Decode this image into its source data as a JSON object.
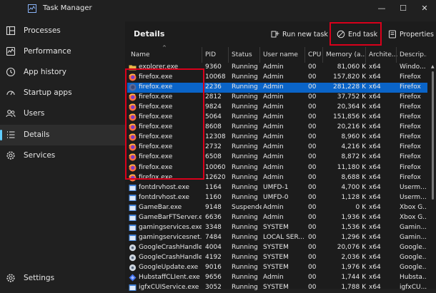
{
  "window": {
    "title": "Task Manager",
    "minimize": "—",
    "maximize": "☐",
    "close": "✕"
  },
  "sidebar": {
    "items": [
      {
        "label": "Processes",
        "icon": "grid-icon"
      },
      {
        "label": "Performance",
        "icon": "performance-icon"
      },
      {
        "label": "App history",
        "icon": "history-icon"
      },
      {
        "label": "Startup apps",
        "icon": "speedometer-icon"
      },
      {
        "label": "Users",
        "icon": "users-icon"
      },
      {
        "label": "Details",
        "icon": "list-icon",
        "active": true
      },
      {
        "label": "Services",
        "icon": "gear-icon"
      }
    ],
    "settings": "Settings"
  },
  "page": {
    "heading": "Details",
    "run_new_task": "Run new task",
    "end_task": "End task",
    "properties": "Properties"
  },
  "columns": [
    "Name",
    "PID",
    "Status",
    "User name",
    "CPU",
    "Memory (a...",
    "Archite...",
    "Descrip..."
  ],
  "rows": [
    {
      "name": "explorer.exe",
      "pid": "9360",
      "status": "Running",
      "user": "Admin",
      "cpu": "00",
      "mem": "81,060 K",
      "arch": "x64",
      "desc": "Windo...",
      "icon": "folder"
    },
    {
      "name": "firefox.exe",
      "pid": "10068",
      "status": "Running",
      "user": "Admin",
      "cpu": "00",
      "mem": "157,820 K",
      "arch": "x64",
      "desc": "Firefox",
      "icon": "firefox"
    },
    {
      "name": "firefox.exe",
      "pid": "2236",
      "status": "Running",
      "user": "Admin",
      "cpu": "00",
      "mem": "281,228 K",
      "arch": "x64",
      "desc": "Firefox",
      "icon": "firefox-dim",
      "selected": true
    },
    {
      "name": "firefox.exe",
      "pid": "2812",
      "status": "Running",
      "user": "Admin",
      "cpu": "00",
      "mem": "37,752 K",
      "arch": "x64",
      "desc": "Firefox",
      "icon": "firefox"
    },
    {
      "name": "firefox.exe",
      "pid": "9824",
      "status": "Running",
      "user": "Admin",
      "cpu": "00",
      "mem": "20,364 K",
      "arch": "x64",
      "desc": "Firefox",
      "icon": "firefox"
    },
    {
      "name": "firefox.exe",
      "pid": "5064",
      "status": "Running",
      "user": "Admin",
      "cpu": "00",
      "mem": "151,856 K",
      "arch": "x64",
      "desc": "Firefox",
      "icon": "firefox"
    },
    {
      "name": "firefox.exe",
      "pid": "8608",
      "status": "Running",
      "user": "Admin",
      "cpu": "00",
      "mem": "20,216 K",
      "arch": "x64",
      "desc": "Firefox",
      "icon": "firefox"
    },
    {
      "name": "firefox.exe",
      "pid": "12308",
      "status": "Running",
      "user": "Admin",
      "cpu": "00",
      "mem": "8,960 K",
      "arch": "x64",
      "desc": "Firefox",
      "icon": "firefox"
    },
    {
      "name": "firefox.exe",
      "pid": "2732",
      "status": "Running",
      "user": "Admin",
      "cpu": "00",
      "mem": "4,216 K",
      "arch": "x64",
      "desc": "Firefox",
      "icon": "firefox"
    },
    {
      "name": "firefox.exe",
      "pid": "6508",
      "status": "Running",
      "user": "Admin",
      "cpu": "00",
      "mem": "8,872 K",
      "arch": "x64",
      "desc": "Firefox",
      "icon": "firefox"
    },
    {
      "name": "firefox.exe",
      "pid": "10060",
      "status": "Running",
      "user": "Admin",
      "cpu": "00",
      "mem": "11,180 K",
      "arch": "x64",
      "desc": "Firefox",
      "icon": "firefox"
    },
    {
      "name": "firefox.exe",
      "pid": "12620",
      "status": "Running",
      "user": "Admin",
      "cpu": "00",
      "mem": "8,688 K",
      "arch": "x64",
      "desc": "Firefox",
      "icon": "firefox"
    },
    {
      "name": "fontdrvhost.exe",
      "pid": "1164",
      "status": "Running",
      "user": "UMFD-1",
      "cpu": "00",
      "mem": "4,700 K",
      "arch": "x64",
      "desc": "Userm...",
      "icon": "window"
    },
    {
      "name": "fontdrvhost.exe",
      "pid": "1160",
      "status": "Running",
      "user": "UMFD-0",
      "cpu": "00",
      "mem": "1,128 K",
      "arch": "x64",
      "desc": "Userm...",
      "icon": "window"
    },
    {
      "name": "GameBar.exe",
      "pid": "9148",
      "status": "Suspended",
      "user": "Admin",
      "cpu": "00",
      "mem": "0 K",
      "arch": "x64",
      "desc": "Xbox G...",
      "icon": "window"
    },
    {
      "name": "GameBarFTServer.exe",
      "pid": "6636",
      "status": "Running",
      "user": "Admin",
      "cpu": "00",
      "mem": "1,936 K",
      "arch": "x64",
      "desc": "Xbox G...",
      "icon": "window"
    },
    {
      "name": "gamingservices.exe",
      "pid": "3348",
      "status": "Running",
      "user": "SYSTEM",
      "cpu": "00",
      "mem": "1,536 K",
      "arch": "x64",
      "desc": "Gamin...",
      "icon": "window"
    },
    {
      "name": "gamingservicesnet.exe",
      "pid": "7484",
      "status": "Running",
      "user": "LOCAL SER...",
      "cpu": "00",
      "mem": "1,296 K",
      "arch": "x64",
      "desc": "Gamin...",
      "icon": "window"
    },
    {
      "name": "GoogleCrashHandler....",
      "pid": "4004",
      "status": "Running",
      "user": "SYSTEM",
      "cpu": "00",
      "mem": "20,076 K",
      "arch": "x64",
      "desc": "Google...",
      "icon": "gear"
    },
    {
      "name": "GoogleCrashHandler....",
      "pid": "4192",
      "status": "Running",
      "user": "SYSTEM",
      "cpu": "00",
      "mem": "2,036 K",
      "arch": "x64",
      "desc": "Google...",
      "icon": "gear"
    },
    {
      "name": "GoogleUpdate.exe",
      "pid": "9016",
      "status": "Running",
      "user": "SYSTEM",
      "cpu": "00",
      "mem": "1,976 K",
      "arch": "x64",
      "desc": "Google...",
      "icon": "gear"
    },
    {
      "name": "HubstaffCLIent.exe",
      "pid": "9656",
      "status": "Running",
      "user": "Admin",
      "cpu": "00",
      "mem": "1,744 K",
      "arch": "x64",
      "desc": "Hubsta...",
      "icon": "hubstaff"
    },
    {
      "name": "igfxCUIService.exe",
      "pid": "3052",
      "status": "Running",
      "user": "SYSTEM",
      "cpu": "00",
      "mem": "1,788 K",
      "arch": "x64",
      "desc": "igfxCU...",
      "icon": "window"
    }
  ]
}
